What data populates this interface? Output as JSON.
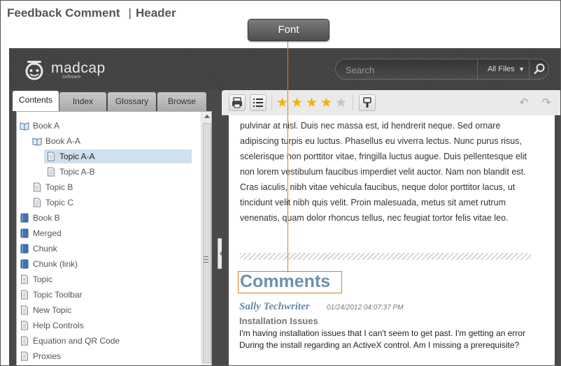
{
  "page_heading": {
    "left": "Feedback Comment",
    "separator": "|",
    "right": "Header"
  },
  "callout": {
    "label": "Font"
  },
  "header": {
    "logo_text": "madcap",
    "logo_sub": "software",
    "search_placeholder": "Search",
    "filter_label": "All Files",
    "filter_chevron": "▼"
  },
  "tabs": [
    {
      "label": "Contents",
      "active": true
    },
    {
      "label": "Index",
      "active": false
    },
    {
      "label": "Glossary",
      "active": false
    },
    {
      "label": "Browse",
      "active": false
    }
  ],
  "toc": [
    {
      "label": "Book A",
      "type": "book-open",
      "level": 0,
      "selected": false
    },
    {
      "label": "Book A-A",
      "type": "book-open",
      "level": 1,
      "selected": false
    },
    {
      "label": "Topic A-A",
      "type": "topic",
      "level": 2,
      "selected": true
    },
    {
      "label": "Topic A-B",
      "type": "topic",
      "level": 2,
      "selected": false
    },
    {
      "label": "Topic B",
      "type": "topic",
      "level": 1,
      "selected": false
    },
    {
      "label": "Topic C",
      "type": "topic",
      "level": 1,
      "selected": false
    },
    {
      "label": "Book B",
      "type": "book",
      "level": 0,
      "selected": false
    },
    {
      "label": "Merged",
      "type": "book",
      "level": 0,
      "selected": false
    },
    {
      "label": "Chunk",
      "type": "book",
      "level": 0,
      "selected": false
    },
    {
      "label": "Chunk (link)",
      "type": "book",
      "level": 0,
      "selected": false
    },
    {
      "label": "Topic",
      "type": "topic",
      "level": 0,
      "selected": false
    },
    {
      "label": "Topic Toolbar",
      "type": "topic",
      "level": 0,
      "selected": false
    },
    {
      "label": "New Topic",
      "type": "topic",
      "level": 0,
      "selected": false
    },
    {
      "label": "Help Controls",
      "type": "topic",
      "level": 0,
      "selected": false
    },
    {
      "label": "Equation and QR Code",
      "type": "topic",
      "level": 0,
      "selected": false
    },
    {
      "label": "Proxies",
      "type": "topic",
      "level": 0,
      "selected": false
    }
  ],
  "toolbar": {
    "rating": 4,
    "rating_max": 5,
    "star_glyph": "★",
    "back_glyph": "↶",
    "forward_glyph": "↷"
  },
  "content": {
    "body_text": "pulvinar at nisl. Duis nec massa est, id hendrerit neque. Sed ornare adipiscing turpis eu luctus. Phasellus eu viverra lectus. Nunc purus risus, scelerisque non porttitor vitae, fringilla luctus augue. Duis pellentesque elit non lorem vestibulum faucibus imperdiet velit auctor. Nam non blandit est. Cras iaculis, nibh vitae vehicula faucibus, neque dolor porttitor lacus, ut tincidunt velit nibh quis velit. Proin malesuada, metus sit amet rutrum venenatis, quam dolor rhoncus tellus, nec feugiat tortor felis vitae leo.",
    "comments_heading": "Comments",
    "comment": {
      "author": "Sally Techwriter",
      "timestamp": "01/24/2012 04:07:37 PM",
      "subject": "Installation Issues",
      "body": "I'm having installation issues that I can't seem to get past. I'm getting an error During the install regarding an ActiveX control. Am I missing a prerequisite?"
    }
  },
  "colors": {
    "header_bg": "#414141",
    "selection": "#cfe0ee",
    "accent_orange": "#d9821e",
    "comments_blue": "#6f8fad",
    "star_gold": "#f0b400",
    "star_gray": "#c4c4c4"
  }
}
